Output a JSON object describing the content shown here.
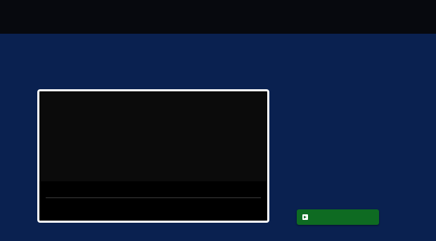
{
  "colors": {
    "topbar": "#07090e",
    "background": "#0a2150",
    "card_border": "#ffffff",
    "player_screen": "#0b0b0b",
    "player_controls": "#000000",
    "button": "#0e6b22"
  },
  "player": {
    "progress": 0
  },
  "action_button": {
    "label": "",
    "icon": "enter-icon"
  }
}
